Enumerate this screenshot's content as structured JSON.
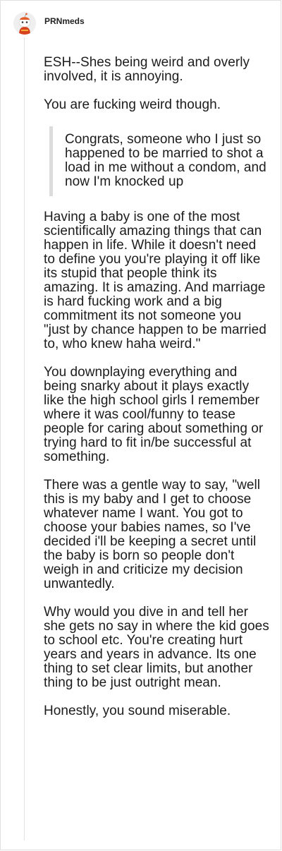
{
  "comment": {
    "username": "PRNmeds",
    "avatar_icon": "reddit-snoo-avatar-icon",
    "paragraphs_before_quote": [
      "ESH--Shes being weird and overly involved, it is annoying.",
      "You are fucking weird though."
    ],
    "quote": "Congrats, someone who I just so happened to be married to shot a load in me without a condom, and now I'm knocked up",
    "paragraphs_after_quote": [
      "Having a baby is one of the most scientifically amazing things that can happen in life. While it doesn't need to define you you're playing it off like its stupid that people think its amazing. It is amazing. And marriage is hard fucking work and a big commitment its not someone you \"just by chance happen to be married to, who knew haha weird.\"",
      "You downplaying everything and being snarky about it plays exactly like the high school girls I remember where it was cool/funny to tease people for caring about something or trying hard to fit in/be successful at something.",
      "There was a gentle way to say, \"well this is my baby and I get to choose whatever name I want. You got to choose your babies names, so I've decided i'll be keeping a secret until the baby is born so people don't weigh in and criticize my decision unwantedly.",
      "Why would you dive in and tell her she gets no say in where the kid goes to school etc. You're creating hurt years and years in advance. Its one thing to set clear limits, but another thing to be just outright mean.",
      "Honestly, you sound miserable."
    ]
  }
}
